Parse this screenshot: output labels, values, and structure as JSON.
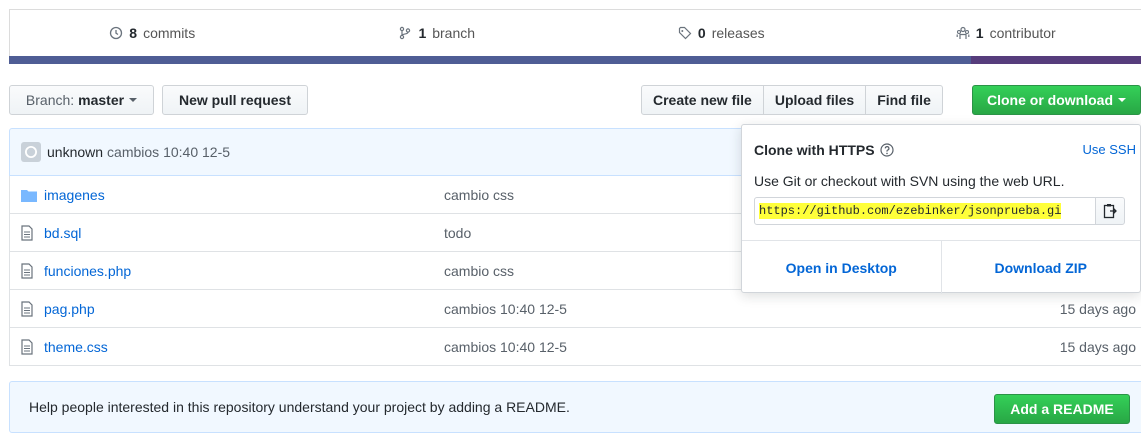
{
  "stats": {
    "commits_count": "8",
    "commits_label": "commits",
    "branch_count": "1",
    "branch_label": "branch",
    "releases_count": "0",
    "releases_label": "releases",
    "contributor_count": "1",
    "contributor_label": "contributor"
  },
  "language_colors": {
    "php": "#4f5d95",
    "css": "#563d7c"
  },
  "toolbar": {
    "branch_prefix": "Branch:",
    "branch_name": "master",
    "new_pull_request": "New pull request",
    "create_new_file": "Create new file",
    "upload_files": "Upload files",
    "find_file": "Find file",
    "clone_or_download": "Clone or download"
  },
  "commit": {
    "author": "unknown",
    "message": "cambios 10:40 12-5"
  },
  "files": [
    {
      "icon": "folder-icon",
      "name": "imagenes",
      "message": "cambio css",
      "age": ""
    },
    {
      "icon": "file-icon",
      "name": "bd.sql",
      "message": "todo",
      "age": ""
    },
    {
      "icon": "file-icon",
      "name": "funciones.php",
      "message": "cambio css",
      "age": ""
    },
    {
      "icon": "file-icon",
      "name": "pag.php",
      "message": "cambios 10:40 12-5",
      "age": "15 days ago"
    },
    {
      "icon": "file-icon",
      "name": "theme.css",
      "message": "cambios 10:40 12-5",
      "age": "15 days ago"
    }
  ],
  "readme": {
    "message": "Help people interested in this repository understand your project by adding a README.",
    "button": "Add a README"
  },
  "clone_popup": {
    "title": "Clone with HTTPS",
    "use_ssh": "Use SSH",
    "description": "Use Git or checkout with SVN using the web URL.",
    "url": "https://github.com/ezebinker/jsonprueba.gi",
    "open_in_desktop": "Open in Desktop",
    "download_zip": "Download ZIP"
  },
  "colors": {
    "accent_green": "#28a745",
    "link_blue": "#0366d6",
    "highlight_yellow": "#ffff3a"
  }
}
